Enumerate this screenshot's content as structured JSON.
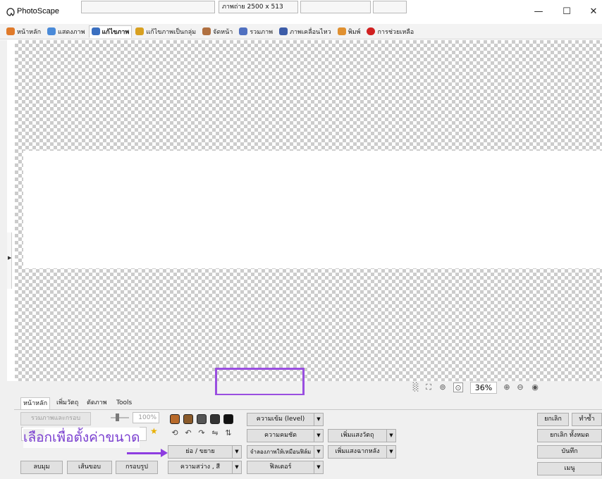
{
  "window": {
    "title": "PhotoScape",
    "controls": {
      "minimize": "—",
      "maximize": "☐",
      "close": "✕"
    }
  },
  "tabs": [
    {
      "label": "หน้าหลัก",
      "icon": "home-icon",
      "color": "#e07a2a"
    },
    {
      "label": "แสดงภาพ",
      "icon": "viewer-icon",
      "color": "#4a8ad8"
    },
    {
      "label": "แก้ไขภาพ",
      "icon": "editor-icon",
      "color": "#3a6fc0",
      "active": true
    },
    {
      "label": "แก้ไขภาพเป็นกลุ่ม",
      "icon": "batch-editor-icon",
      "color": "#d8a020"
    },
    {
      "label": "จัดหน้า",
      "icon": "page-icon",
      "color": "#b07040"
    },
    {
      "label": "รวมภาพ",
      "icon": "combine-icon",
      "color": "#5070c0"
    },
    {
      "label": "ภาพเคลื่อนไหว",
      "icon": "animated-gif-icon",
      "color": "#3c5ca8"
    },
    {
      "label": "พิมพ์",
      "icon": "print-icon",
      "color": "#e09030"
    },
    {
      "label": "การช่วยเหลือ",
      "icon": "help-icon",
      "color": "#d02020"
    }
  ],
  "status": {
    "image_size": "ภาพถ่าย 2500 x 513",
    "zoom": "36%"
  },
  "panel": {
    "tabs": [
      "หน้าหลัก",
      "เพิ่มวัตถุ",
      "ตัดภาพ",
      "Tools"
    ],
    "combine_frame_btn": "รวมภาพและกรอบ",
    "slider_pct": "100%",
    "instruction": "เลือกเพื่อตั้งค่าขนาด",
    "round_btn": "ลบมุม",
    "border_btn": "เส้นขอบ",
    "frame_btn": "กรอบรูป",
    "level_btn": "ความเข้ม (level)",
    "sharpen_btn": "ความคมชัด",
    "resize_btn": "ย่อ / ขยาย",
    "brightness_btn": "ความสว่าง , สี",
    "film_btn": "จำลองภาพให้เหมือนฟิล์ม",
    "filter_btn": "ฟิลเตอร์",
    "add_light_btn": "เพิ่มแสงวัตถุ",
    "backlight_btn": "เพิ่มแสงฉากหลัง",
    "undo_btn": "ยกเลิก",
    "redo_btn": "ทำซ้ำ",
    "undo_all_btn": "ยกเลิก ทั้งหมด",
    "save_btn": "บันทึก",
    "menu_btn": "เมนู"
  },
  "colors": {
    "highlight": "#9a4ee0",
    "annotation_arrow": "#8e3de0",
    "instruction_text": "#7a3fd0"
  }
}
